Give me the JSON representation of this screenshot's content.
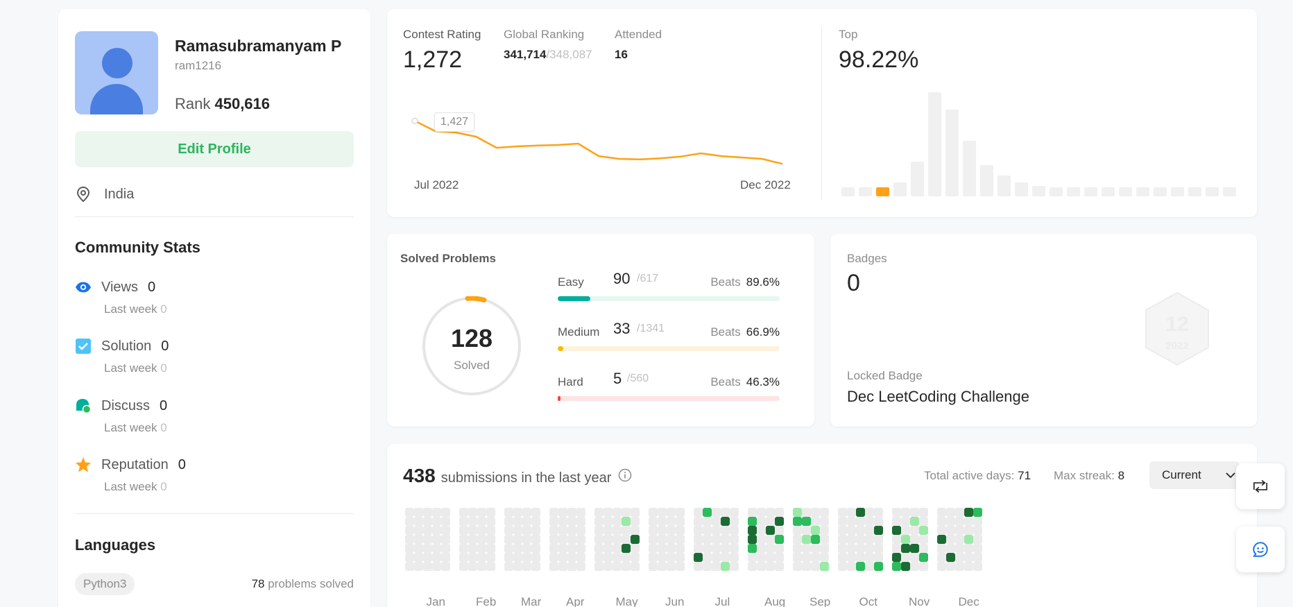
{
  "profile": {
    "name": "Ramasubramanyam P",
    "username": "ram1216",
    "rank_label": "Rank",
    "rank_value": "450,616",
    "edit_label": "Edit Profile",
    "location": "India"
  },
  "community": {
    "title": "Community Stats",
    "last_week_label": "Last week",
    "items": [
      {
        "label": "Views",
        "value": "0",
        "last_week": "0",
        "icon": "eye-icon",
        "color": "#1a73e8"
      },
      {
        "label": "Solution",
        "value": "0",
        "last_week": "0",
        "icon": "check-square-icon",
        "color": "#4fc3f7"
      },
      {
        "label": "Discuss",
        "value": "0",
        "last_week": "0",
        "icon": "discuss-icon",
        "color": "#00af9b"
      },
      {
        "label": "Reputation",
        "value": "0",
        "last_week": "0",
        "icon": "star-icon",
        "color": "#ffa116"
      }
    ]
  },
  "languages": {
    "title": "Languages",
    "items": [
      {
        "name": "Python3",
        "count": "78",
        "suffix": "problems solved"
      }
    ]
  },
  "contest": {
    "rating_label": "Contest Rating",
    "rating": "1,272",
    "global_label": "Global Ranking",
    "global_rank": "341,714",
    "global_total": "/348,087",
    "attended_label": "Attended",
    "attended": "16",
    "top_label": "Top",
    "top_value": "98.22%",
    "tooltip": "1,427",
    "x_start": "Jul 2022",
    "x_end": "Dec 2022",
    "accent": "#ffa116"
  },
  "chart_data": [
    {
      "type": "line",
      "title": "Contest Rating",
      "xlabel": "",
      "ylabel": "",
      "x": [
        "Jul 2022",
        "",
        "",
        "",
        "",
        "",
        "",
        "",
        "",
        "",
        "",
        "",
        "",
        "",
        "",
        "Dec 2022"
      ],
      "series": [
        {
          "values": [
            1427,
            1390,
            1385,
            1370,
            1330,
            1335,
            1338,
            1340,
            1345,
            1300,
            1290,
            1288,
            1292,
            1298,
            1310,
            1300,
            1295,
            1290,
            1272
          ]
        }
      ]
    },
    {
      "type": "bar",
      "title": "Top",
      "categories": [
        "1",
        "2",
        "3",
        "4",
        "5",
        "6",
        "7",
        "8",
        "9",
        "10",
        "11",
        "12",
        "13",
        "14",
        "15",
        "16",
        "17",
        "18",
        "19",
        "20",
        "21",
        "22",
        "23"
      ],
      "values": [
        2,
        2,
        2,
        4,
        10,
        30,
        25,
        16,
        9,
        6,
        4,
        3,
        2,
        2,
        2,
        2,
        2,
        2,
        2,
        2,
        2,
        2,
        2
      ],
      "highlight_index": 2
    }
  ],
  "solved": {
    "title": "Solved Problems",
    "total": "128",
    "total_label": "Solved",
    "difficulties": [
      {
        "name": "Easy",
        "solved": "90",
        "total": "/617",
        "beats_label": "Beats",
        "beats": "89.6%",
        "fill": 0.146,
        "color": "#00af9b",
        "track": "#e6f7f0"
      },
      {
        "name": "Medium",
        "solved": "33",
        "total": "/1341",
        "beats_label": "Beats",
        "beats": "66.9%",
        "fill": 0.025,
        "color": "#ffb800",
        "track": "#fdf3dc"
      },
      {
        "name": "Hard",
        "solved": "5",
        "total": "/560",
        "beats_label": "Beats",
        "beats": "46.3%",
        "fill": 0.009,
        "color": "#ef4743",
        "track": "#fde4e3"
      }
    ]
  },
  "badges": {
    "title": "Badges",
    "count": "0",
    "locked_label": "Locked Badge",
    "locked_name": "Dec LeetCoding Challenge",
    "hex_top": "12",
    "hex_bottom": "2022"
  },
  "heatmap": {
    "count": "438",
    "text": "submissions in the last year",
    "active_label": "Total active days:",
    "active_value": "71",
    "streak_label": "Max streak:",
    "streak_value": "8",
    "select_value": "Current",
    "months": [
      "Jan",
      "Feb",
      "Mar",
      "Apr",
      "May",
      "Jun",
      "Jul",
      "Aug",
      "Sep",
      "Oct",
      "Nov",
      "Dec"
    ]
  }
}
